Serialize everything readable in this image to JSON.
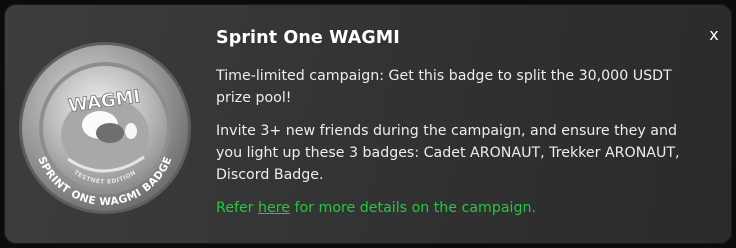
{
  "modal": {
    "title": "Sprint One WAGMI",
    "close_label": "x",
    "paragraph_1": "Time-limited campaign: Get this badge to split the 30,000 USDT prize pool!",
    "paragraph_2": "Invite 3+ new friends during the campaign, and ensure they and you light up these 3 badges: Cadet ARONAUT, Trekker ARONAUT, Discord Badge.",
    "refer_prefix": "Refer ",
    "refer_link": "here",
    "refer_suffix": " for more details on the campaign."
  },
  "badge": {
    "logo_text": "WAGMI",
    "ring_text": "SPRINT ONE WAGMI BADGE",
    "edition_text": "TESTNET EDITION"
  },
  "colors": {
    "link_green": "#22c940",
    "background": "#363636"
  }
}
